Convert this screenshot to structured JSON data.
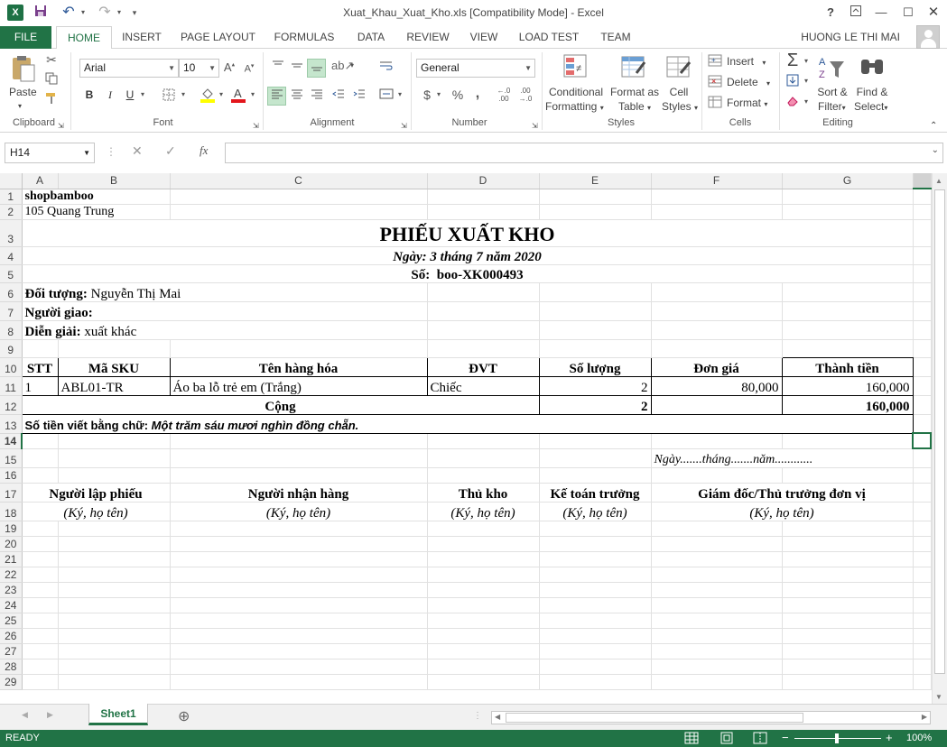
{
  "window": {
    "title": "Xuat_Khau_Xuat_Kho.xls  [Compatibility Mode] - Excel",
    "help": "?",
    "user": "HUONG LE THI MAI"
  },
  "tabs": [
    "FILE",
    "HOME",
    "INSERT",
    "PAGE LAYOUT",
    "FORMULAS",
    "DATA",
    "REVIEW",
    "VIEW",
    "LOAD TEST",
    "TEAM"
  ],
  "ribbon": {
    "clipboard": {
      "paste": "Paste",
      "label": "Clipboard"
    },
    "font": {
      "name": "Arial",
      "size": "10",
      "bold": "B",
      "italic": "I",
      "underline": "U",
      "label": "Font"
    },
    "alignment": {
      "label": "Alignment"
    },
    "number": {
      "format": "General",
      "currency": "$",
      "percent": "%",
      "comma": ",",
      "label": "Number"
    },
    "styles": {
      "conditional": "Conditional",
      "conditional2": "Formatting",
      "format_as": "Format as",
      "format_as2": "Table",
      "cell": "Cell",
      "cell2": "Styles",
      "label": "Styles"
    },
    "cells": {
      "insert": "Insert",
      "delete": "Delete",
      "format": "Format",
      "label": "Cells"
    },
    "editing": {
      "sort": "Sort &",
      "sort2": "Filter",
      "find": "Find &",
      "find2": "Select",
      "label": "Editing"
    }
  },
  "formula_bar": {
    "name_box": "H14",
    "fx": "fx",
    "value": ""
  },
  "columns": [
    "A",
    "B",
    "C",
    "D",
    "E",
    "F",
    "G"
  ],
  "rows": [
    "1",
    "2",
    "3",
    "4",
    "5",
    "6",
    "7",
    "8",
    "9",
    "10",
    "11",
    "12",
    "13",
    "14",
    "15",
    "16",
    "17",
    "18",
    "19",
    "20",
    "21",
    "22",
    "23",
    "24",
    "25",
    "26",
    "27",
    "28",
    "29"
  ],
  "sheet": {
    "a1": "shopbamboo",
    "a2": "105 Quang Trung",
    "title": "PHIẾU XUẤT KHO",
    "date": "Ngày: 3 tháng 7 năm 2020",
    "number_label": "Số:",
    "number_value": "boo-XK000493",
    "doi_tuong_label": "Đối tượng:",
    "doi_tuong_value": "Nguyễn Thị Mai",
    "nguoi_giao_label": "Người giao:",
    "dien_giai_label": "Diễn giải:",
    "dien_giai_value": "xuất khác",
    "table_headers": [
      "STT",
      "Mã SKU",
      "Tên hàng hóa",
      "ĐVT",
      "Số lượng",
      "Đơn giá",
      "Thành tiền"
    ],
    "items": [
      {
        "stt": "1",
        "sku": "ABL01-TR",
        "name": "Áo ba lỗ trẻ em (Trắng)",
        "unit": "Chiếc",
        "qty": "2",
        "price": "80,000",
        "amount": "160,000"
      }
    ],
    "total_label": "Cộng",
    "total_qty": "2",
    "total_amount": "160,000",
    "words_label": "Số tiền viết bằng chữ:",
    "words_value": "Một trăm sáu mươi nghìn đồng chẵn.",
    "date_blank": "Ngày.......tháng.......năm............",
    "signers": [
      "Người lập phiếu",
      "Người nhận hàng",
      "Thủ kho",
      "Kế toán trưởng",
      "Giám đốc/Thủ trưởng đơn vị"
    ],
    "sign_note": "(Ký, họ tên)"
  },
  "sheet_tabs": {
    "active": "Sheet1",
    "add": "⊕"
  },
  "status": {
    "ready": "READY",
    "zoom": "100%"
  }
}
